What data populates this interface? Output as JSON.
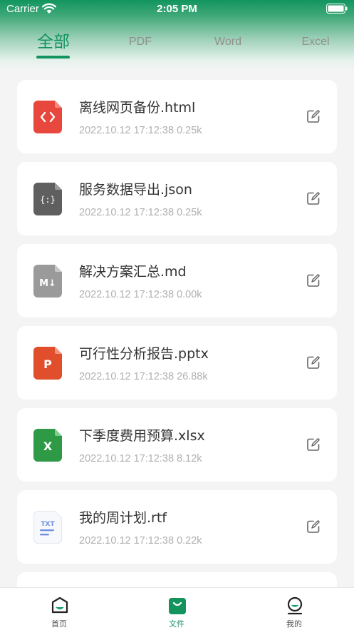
{
  "status_bar": {
    "carrier": "Carrier",
    "time": "2:05 PM"
  },
  "tabs": [
    {
      "label": "全部",
      "active": true
    },
    {
      "label": "PDF",
      "active": false
    },
    {
      "label": "Word",
      "active": false
    },
    {
      "label": "Excel",
      "active": false
    }
  ],
  "files": [
    {
      "name": "离线网页备份.html",
      "meta": "2022.10.12 17:12:38 0.25k",
      "type": "html"
    },
    {
      "name": "服务数据导出.json",
      "meta": "2022.10.12 17:12:38 0.25k",
      "type": "json"
    },
    {
      "name": "解决方案汇总.md",
      "meta": "2022.10.12 17:12:38 0.00k",
      "type": "md"
    },
    {
      "name": "可行性分析报告.pptx",
      "meta": "2022.10.12 17:12:38 26.88k",
      "type": "pptx"
    },
    {
      "name": "下季度费用预算.xlsx",
      "meta": "2022.10.12 17:12:38 8.12k",
      "type": "xlsx"
    },
    {
      "name": "我的周计划.rtf",
      "meta": "2022.10.12 17:12:38 0.22k",
      "type": "rtf"
    }
  ],
  "icon_text": {
    "md": "M↓",
    "pptx": "P",
    "xlsx": "X",
    "rtf": "TXT",
    "json": "{:}"
  },
  "tabbar": [
    {
      "label": "首页",
      "icon": "home-icon",
      "active": false
    },
    {
      "label": "文件",
      "icon": "file-bag-icon",
      "active": true
    },
    {
      "label": "我的",
      "icon": "profile-icon",
      "active": false
    }
  ],
  "colors": {
    "brand": "#13935e",
    "html": "#e8473d",
    "json": "#5f5f5f",
    "md": "#9a9a9a",
    "pptx": "#e04e2c",
    "xlsx": "#2f9a45",
    "rtf": "#6f8fe0"
  }
}
